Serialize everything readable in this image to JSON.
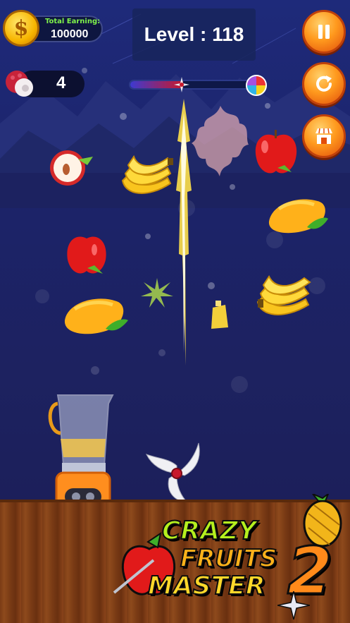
{
  "hud": {
    "earning_label": "Total Earning:",
    "earning_value": "100000",
    "coin_symbol": "$",
    "level_text": "Level : 118",
    "lychee_count": "4"
  },
  "progress": {
    "fraction": 0.42
  },
  "buttons": {
    "pause_icon": "pause-icon",
    "restart_icon": "restart-icon",
    "shop_icon": "shop-icon"
  },
  "logo": {
    "line1": "CRAZY",
    "line2": "FRUITS",
    "line3": "MASTER",
    "number": "2"
  },
  "colors": {
    "sky": "#1e2a7a",
    "earning_label": "#7ff24a",
    "button_orange": "#ff9a1e",
    "blade": "#ffe14a"
  }
}
